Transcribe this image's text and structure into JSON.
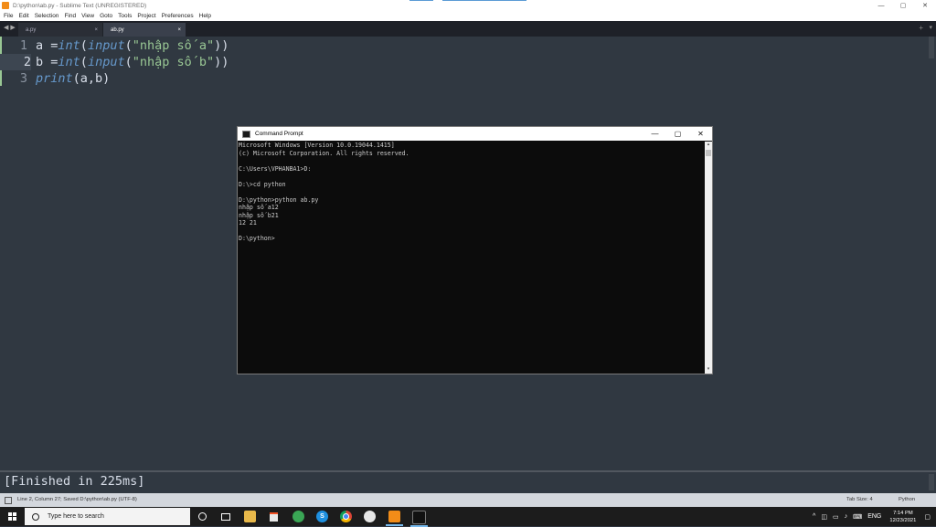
{
  "window": {
    "title": "D:\\python\\ab.py - Sublime Text (UNREGISTERED)",
    "controls": [
      "—",
      "▢",
      "✕"
    ]
  },
  "menu": [
    "File",
    "Edit",
    "Selection",
    "Find",
    "View",
    "Goto",
    "Tools",
    "Project",
    "Preferences",
    "Help"
  ],
  "tabs": [
    {
      "label": "a.py",
      "close": "×"
    },
    {
      "label": "ab.py",
      "close": "×"
    }
  ],
  "tabbar": {
    "nav": "◀ ▶",
    "add": "+",
    "dropdown": "▾"
  },
  "editor": {
    "line_numbers": [
      "1",
      "2",
      "3"
    ],
    "lines": [
      [
        {
          "t": "a ",
          "c": "op"
        },
        {
          "t": "=",
          "c": "op"
        },
        {
          "t": "int",
          "c": "fn"
        },
        {
          "t": "(",
          "c": "op"
        },
        {
          "t": "input",
          "c": "fn"
        },
        {
          "t": "(",
          "c": "op"
        },
        {
          "t": "\"nhập số a\"",
          "c": "str"
        },
        {
          "t": "))",
          "c": "op"
        }
      ],
      [
        {
          "t": "b ",
          "c": "op"
        },
        {
          "t": "=",
          "c": "op"
        },
        {
          "t": "int",
          "c": "fn"
        },
        {
          "t": "(",
          "c": "op"
        },
        {
          "t": "input",
          "c": "fn"
        },
        {
          "t": "(",
          "c": "op"
        },
        {
          "t": "\"nhập số b\"",
          "c": "str"
        },
        {
          "t": "))",
          "c": "op"
        }
      ],
      [
        {
          "t": "print",
          "c": "fn"
        },
        {
          "t": "(a,b)",
          "c": "op"
        }
      ]
    ]
  },
  "cmd": {
    "title": "Command Prompt",
    "controls": [
      "—",
      "▢",
      "✕"
    ],
    "scroll_up": "▴",
    "scroll_down": "▾",
    "lines": [
      "Microsoft Windows [Version 10.0.19044.1415]",
      "(c) Microsoft Corporation. All rights reserved.",
      "",
      "C:\\Users\\VPHANBA1>D:",
      "",
      "D:\\>cd python",
      "",
      "D:\\python>python ab.py",
      "nhập số a12",
      "nhập số b21",
      "12 21",
      "",
      "D:\\python>"
    ]
  },
  "output_panel": {
    "text": "[Finished in 225ms]"
  },
  "statusbar": {
    "message": "Line 2, Column 27; Saved D:\\python\\ab.py (UTF-8)",
    "tab_size": "Tab Size: 4",
    "syntax": "Python"
  },
  "taskbar": {
    "search_placeholder": "Type here to search",
    "tray_lang": "ENG",
    "time": "7:14 PM",
    "date": "12/23/2021"
  },
  "colors": {
    "editor_bg": "#303841",
    "function": "#6699cc",
    "string": "#99c794",
    "console_bg": "#0c0c0c"
  }
}
